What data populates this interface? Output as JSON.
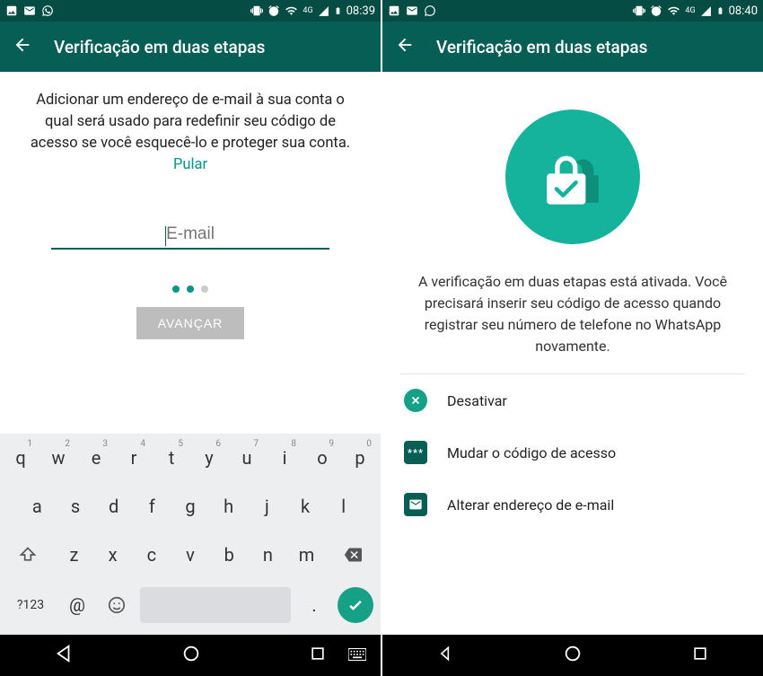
{
  "left": {
    "status": {
      "time": "08:39",
      "network": "4G"
    },
    "app_bar": {
      "title": "Verificação em duas etapas"
    },
    "description": "Adicionar um endereço de e-mail à sua conta o qual será usado para redefinir seu código de acesso se você esquecê-lo e proteger sua conta. ",
    "skip_label": "Pular",
    "email_placeholder": "E-mail",
    "advance_label": "AVANÇAR",
    "keyboard": {
      "row1": [
        "q",
        "w",
        "e",
        "r",
        "t",
        "y",
        "u",
        "i",
        "o",
        "p"
      ],
      "row1_sup": [
        "1",
        "2",
        "3",
        "4",
        "5",
        "6",
        "7",
        "8",
        "9",
        "0"
      ],
      "row2": [
        "a",
        "s",
        "d",
        "f",
        "g",
        "h",
        "j",
        "k",
        "l"
      ],
      "row3": [
        "z",
        "x",
        "c",
        "v",
        "b",
        "n",
        "m"
      ],
      "sym_key": "?123",
      "at_key": "@",
      "period_key": "."
    }
  },
  "right": {
    "status": {
      "time": "08:40",
      "network": "4G"
    },
    "app_bar": {
      "title": "Verificação em duas etapas"
    },
    "description": "A verificação em duas etapas está ativada. Você precisará inserir seu código de acesso quando registrar seu número de telefone no WhatsApp novamente.",
    "options": {
      "disable": "Desativar",
      "change_code": "Mudar o código de acesso",
      "change_email": "Alterar endereço de e-mail"
    }
  }
}
